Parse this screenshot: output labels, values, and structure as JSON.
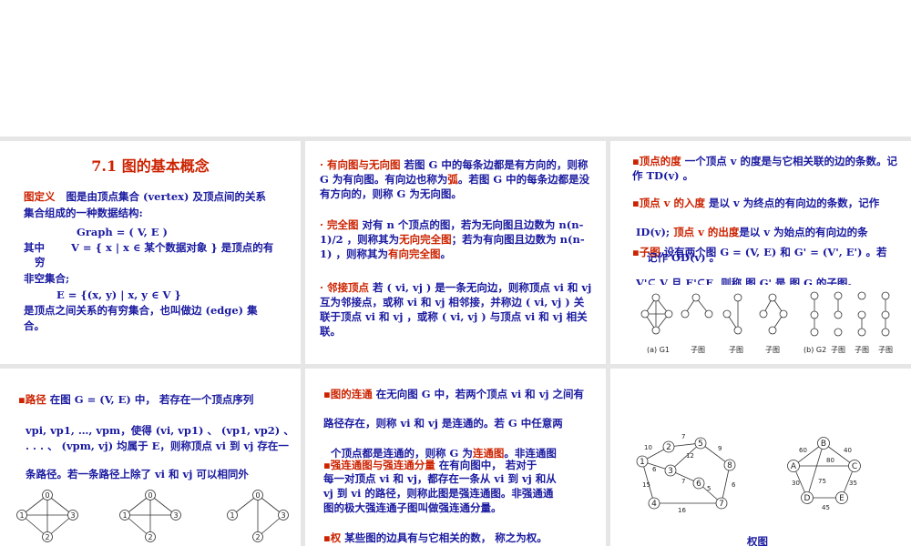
{
  "s1": {
    "title": "7.1   图的基本概念",
    "def_head": "图定义",
    "def_line1": "图是由顶点集合 (vertex) 及顶点间的关系",
    "def_line2": "集合组成的一种数据结构:",
    "formula1": "Graph = ( V, E )",
    "where_head": "其中",
    "formula2": "V = { x | x ∈ 某个数据对象 } 是顶点的有穷",
    "nonempty": "非空集合;",
    "formula3": "E = {(x, y) | x, y ∈ V }",
    "rel_line1": "是顶点之间关系的有穷集合，也叫做边 (edge) 集",
    "rel_line2": "合。"
  },
  "s2": {
    "p1_head": "有向图与无向图",
    "p1_text": " 若图 G 中的每条边都是有方向的，则称 G 为有向图。有向边也称为",
    "p1_arc": "弧",
    "p1_tail": "。若图 G 中的每条边都是没有方向的，则称 G 为无向图。",
    "p2_head": "完全图",
    "p2_text": " 对有 n 个顶点的图，若为无向图且边数为 n(n-1)/2 ，则称其为",
    "p2_red1": "无向完全图",
    "p2_mid": "；若为有向图且边数为 n(n-1)  ，则称其为",
    "p2_red2": "有向完全图",
    "p2_end": "。",
    "p3_head": "邻接顶点",
    "p3_text": " 若 ( vi, vj ) 是一条无向边，则称顶点 vi 和 vj 互为邻接点，或称 vi 和 vj 相邻接，并称边 ( vi, vj ) 关联于顶点 vi 和 vj ，或称 ( vi, vj ) 与顶点 vi 和 vj 相关联。"
  },
  "s3": {
    "deg_head": "顶点的度",
    "deg_text": "  一个顶点 v 的度是与它相关联的边的条数。记作 TD(v) 。",
    "in_head": "顶点  v  的入度",
    "in_text": " 是以  v  为终点的有向边的条数，记作",
    "in_id": "ID(v);",
    "out_head": "顶点  v  的出度",
    "out_text": "是以  v  为始点的有向边的条",
    "sub_head": "子图",
    "sub_text": "设有两个图  G = (V, E) 和  G' = (V', E') 。若",
    "overlap": "记作  OD(v) 。",
    "cut_line": "V'⊆ V 且  E'⊆E, 则称 图 G' 是 图 G 的子图。",
    "cap_a": "(a) G1",
    "cap_sub": "子图",
    "cap_b": "(b) G2"
  },
  "s4": {
    "head": "路径",
    "line1": "   在图  G = (V,  E)  中，  若存在一个顶点序列",
    "line2": "vpi,  vp1,  …,  vpm，使得 (vi,  vp1) 、 (vp1,  vp2) 、",
    "line3": ". . . 、 (vpm,  vj) 均属于 E，则称顶点 vi 到 vj 存在一",
    "line4": "条路径。若一条路径上除了  vi  和  vj  可以相同外",
    "nodes": [
      "0",
      "1",
      "2",
      "3"
    ]
  },
  "s5": {
    "conn_head": "图的连通",
    "conn_text": " 在无向图 G 中，若两个顶点 vi 和 vj 之间有",
    "conn_l2": "路径存在，则称 vi  和 vj  是连通的。若 G 中任意两",
    "conn_l3": "个顶点都是连通的，则称 G 为",
    "conn_red": "连通图",
    "conn_l3b": "。非连通图",
    "strong_head": "强连通图与强连通分量",
    "strong_text": "  在有向图中，  若对于",
    "strong_l2": "每一对顶点 vi 和 vj，都存在一条从 vi 到 vj 和从",
    "strong_l3": "vj 到 vi 的路径，则称此图是强连通图。非强通通",
    "strong_l4": "图的极大强连通子图叫做强连通分量。",
    "weight_head": "权",
    "weight_text": "  某些图的边具有与它相关的数，  称之为权。"
  },
  "s6": {
    "caption": "权图",
    "g1_nodes": [
      "1",
      "2",
      "3",
      "4",
      "5",
      "6",
      "7",
      "8"
    ],
    "g1_weights": [
      "10",
      "7",
      "9",
      "6",
      "12",
      "7",
      "15",
      "16",
      "6",
      "5"
    ],
    "g2_nodes": [
      "A",
      "B",
      "C",
      "D",
      "E"
    ],
    "g2_weights": [
      "60",
      "40",
      "80",
      "30",
      "75",
      "35",
      "45"
    ]
  },
  "colors": {
    "text": "#1a1aa0",
    "accent": "#cc2200",
    "background": "#e6e6e6"
  }
}
